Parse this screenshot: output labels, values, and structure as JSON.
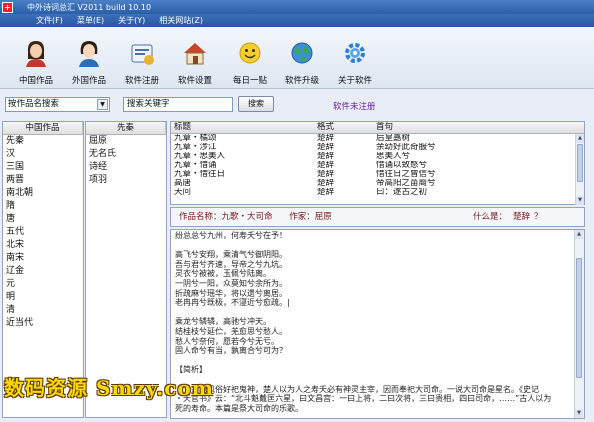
{
  "window": {
    "title": "中外诗词总汇 V2011 build 10.10"
  },
  "menu": [
    "文件(F)",
    "菜单(E)",
    "关于(Y)",
    "相关网站(Z)"
  ],
  "toolbar": [
    {
      "label": "中国作品",
      "icon": "chinese-woman-icon"
    },
    {
      "label": "外国作品",
      "icon": "foreign-woman-icon"
    },
    {
      "label": "软件注册",
      "icon": "register-icon"
    },
    {
      "label": "软件设置",
      "icon": "settings-house-icon"
    },
    {
      "label": "每日一贴",
      "icon": "daily-smiley-icon"
    },
    {
      "label": "软件升级",
      "icon": "upgrade-globe-icon"
    },
    {
      "label": "关于软件",
      "icon": "about-gear-icon"
    }
  ],
  "search": {
    "mode": "按作品名搜索",
    "placeholder": "搜索关键字",
    "button": "搜索",
    "status": "软件未注册"
  },
  "dynasty_panel": {
    "header": "中国作品",
    "items": [
      "先秦",
      "汉",
      "三国",
      "两晋",
      "南北朝",
      "隋",
      "唐",
      "五代",
      "北宋",
      "南宋",
      "辽金",
      "元",
      "明",
      "清",
      "近当代"
    ]
  },
  "author_panel": {
    "header": "先秦",
    "items": [
      "屈原",
      "无名氏",
      "诗经",
      "项羽"
    ]
  },
  "grid": {
    "headers": [
      "标题",
      "格式",
      "首句"
    ],
    "rows": [
      [
        "九章・橘颂",
        "楚辞",
        "后皇嘉树"
      ],
      [
        "九章・涉江",
        "楚辞",
        "余幼好此奇服兮"
      ],
      [
        "九章・思美人",
        "楚辞",
        "思美人兮"
      ],
      [
        "九章・惜诵",
        "楚辞",
        "惜诵以致愍兮"
      ],
      [
        "九章・惜往日",
        "楚辞",
        "惜往日之曾信兮"
      ],
      [
        "高唐",
        "楚辞",
        "帝高阳之苗裔兮"
      ],
      [
        "天问",
        "楚辞",
        "曰：遂古之初"
      ]
    ]
  },
  "info": {
    "title_label": "作品名称：",
    "title_value": "九歌・大司命",
    "author_label": "作家：",
    "author_value": "屈原",
    "what_label": "什么是：",
    "what_value": "楚辞",
    "q": "？"
  },
  "poem": {
    "lines": [
      "纷总总兮九州，何寿夭兮在予！",
      "",
      "高飞兮安翔，乘清气兮御阴阳。",
      "吾与君兮齐速，导帝之兮九坑。",
      "灵衣兮被被，玉佩兮陆离。",
      "一阴兮一阳，众莫知兮余所为。",
      "折疏麻兮瑶华，将以遗兮离居。",
      "老冉冉兮既极，不寖近兮愈疏。|",
      "",
      "乘龙兮辚辚，高驰兮冲天。",
      "结桂枝兮延伫，羌愈思兮愁人。",
      "愁人兮奈何，愿若今兮无亏。",
      "固人命兮有当，孰离合兮可为？",
      "",
      "【简析】",
      "",
      "　　楚地风俗好祀鬼神，楚人以为人之寿夭必有神灵主宰，因而奉祀大司命。一说大司命是星名。《史记",
      "・天官书》云：“北斗魁戴匡六星，曰文昌宫：一曰上将，二曰次将，三曰贵相，四曰司命，……”古人以为",
      "死的寿命。本篇是祭大司命的乐歌。"
    ]
  },
  "watermark": "数码资源 Smzy.com"
}
